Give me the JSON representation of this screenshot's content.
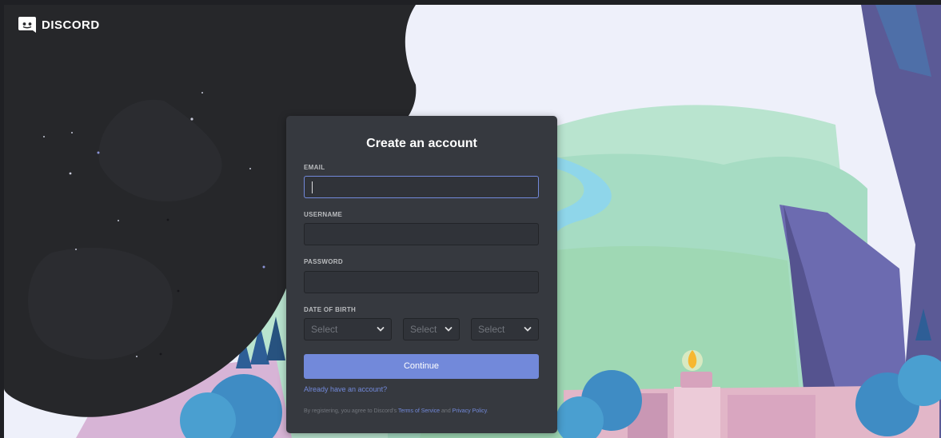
{
  "brand": {
    "name": "DISCORD",
    "logo_icon": "discord-logo-icon"
  },
  "form": {
    "title": "Create an account",
    "email": {
      "label": "EMAIL",
      "value": ""
    },
    "username": {
      "label": "USERNAME",
      "value": ""
    },
    "password": {
      "label": "PASSWORD",
      "value": ""
    },
    "dob": {
      "label": "DATE OF BIRTH",
      "month_placeholder": "Select",
      "day_placeholder": "Select",
      "year_placeholder": "Select",
      "chevron_icon": "chevron-down-icon"
    },
    "continue_label": "Continue",
    "login_link": "Already have an account?",
    "legal": {
      "prefix": "By registering, you agree to Discord's",
      "terms": "Terms of Service",
      "and": "and",
      "privacy": "Privacy Policy",
      "suffix": "."
    }
  },
  "colors": {
    "accent": "#7289da",
    "card_bg": "#36393f",
    "input_bg": "#303339",
    "night_sky": "#26272a"
  }
}
